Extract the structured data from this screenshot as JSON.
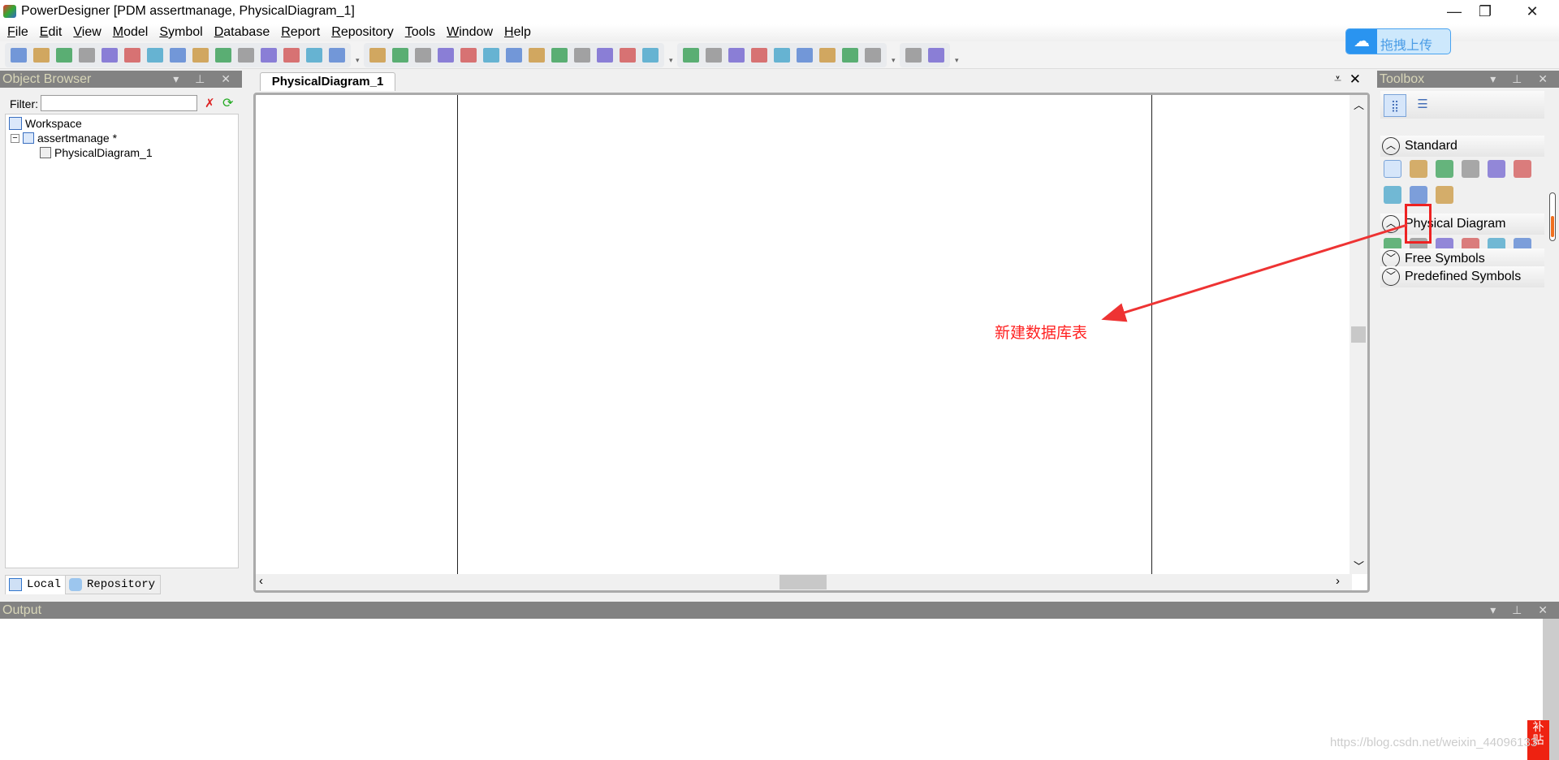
{
  "window": {
    "title": "PowerDesigner [PDM assertmanage, PhysicalDiagram_1]",
    "controls": [
      "minimize",
      "restore",
      "close"
    ]
  },
  "menu": [
    "File",
    "Edit",
    "View",
    "Model",
    "Symbol",
    "Database",
    "Report",
    "Repository",
    "Tools",
    "Window",
    "Help"
  ],
  "toolbar": {
    "groups": [
      [
        "new",
        "open-model",
        "open",
        "save",
        "save-all",
        "print-preview",
        "print",
        "cut",
        "copy",
        "paste",
        "delete",
        "undo",
        "redo",
        "properties",
        "help"
      ],
      [
        "new-package",
        "paste-as-shortcut",
        "find",
        "refresh",
        "check-model",
        "shadow",
        "align",
        "format-painter",
        "line-style",
        "text-font",
        "bring-front",
        "back",
        "forward"
      ],
      [
        "diagram-view",
        "layout",
        "page",
        "pages",
        "import",
        "merge",
        "zoom-view",
        "comment",
        "grid"
      ],
      [
        "print-preview-2",
        "print-2"
      ]
    ]
  },
  "upload": {
    "label": "拖拽上传",
    "icon": "cloud-icon",
    "color": "#2a94f0"
  },
  "object_browser": {
    "title": "Object Browser",
    "filter_label": "Filter:",
    "filter_value": "",
    "tree": [
      {
        "label": "Workspace"
      },
      {
        "label": "assertmanage *"
      },
      {
        "label": "PhysicalDiagram_1"
      }
    ],
    "tabs": [
      "Local",
      "Repository"
    ]
  },
  "diagram": {
    "tab": "PhysicalDiagram_1"
  },
  "toolbox": {
    "title": "Toolbox",
    "sections": [
      {
        "label": "Standard",
        "expanded": true,
        "tools": [
          "pointer",
          "grabber",
          "zoom-in",
          "zoom-out",
          "zoom-to-fit",
          "open-package-diagram",
          "delete-tool",
          "properties-tool",
          "link"
        ]
      },
      {
        "label": "Physical Diagram",
        "expanded": true,
        "tools": [
          "package",
          "table",
          "view",
          "reference",
          "procedure",
          "file"
        ]
      },
      {
        "label": "Free Symbols",
        "expanded": false
      },
      {
        "label": "Predefined Symbols",
        "expanded": false
      }
    ]
  },
  "output": {
    "title": "Output"
  },
  "annotation": {
    "text": "新建数据库表",
    "color": "#ff2222"
  },
  "watermark": "https://blog.csdn.net/weixin_44096133"
}
